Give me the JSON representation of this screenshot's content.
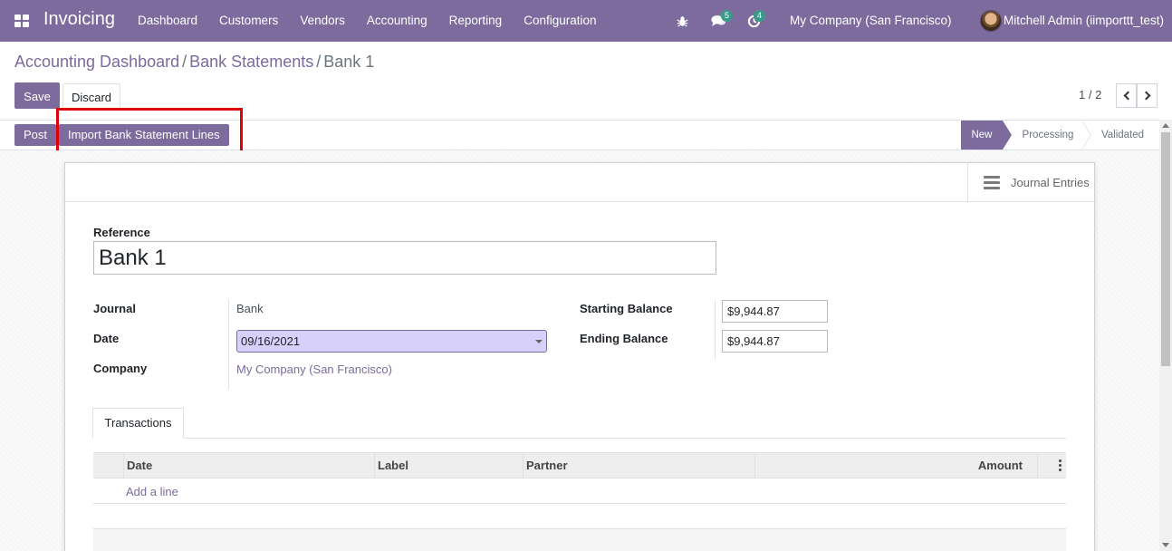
{
  "navbar": {
    "brand": "Invoicing",
    "menu": [
      "Dashboard",
      "Customers",
      "Vendors",
      "Accounting",
      "Reporting",
      "Configuration"
    ],
    "messages_count": "5",
    "activities_count": "4",
    "company": "My Company (San Francisco)",
    "user": "Mitchell Admin (iimporttt_test)"
  },
  "breadcrumb": {
    "items": [
      "Accounting Dashboard",
      "Bank Statements"
    ],
    "separator": "/",
    "current": "Bank 1"
  },
  "actions": {
    "save_label": "Save",
    "discard_label": "Discard"
  },
  "pager": {
    "value": "1 / 2"
  },
  "statusbar": {
    "post_label": "Post",
    "import_label": "Import Bank Statement Lines",
    "stages": [
      "New",
      "Processing",
      "Validated"
    ],
    "active_stage": "New"
  },
  "smart_button": {
    "label": "Journal Entries"
  },
  "form": {
    "reference_label": "Reference",
    "reference_value": "Bank 1",
    "journal_label": "Journal",
    "journal_value": "Bank",
    "date_label": "Date",
    "date_value": "09/16/2021",
    "company_label": "Company",
    "company_value": "My Company (San Francisco)",
    "starting_balance_label": "Starting Balance",
    "starting_balance_value": "$9,944.87",
    "ending_balance_label": "Ending Balance",
    "ending_balance_value": "$9,944.87"
  },
  "tabs": {
    "transactions": "Transactions"
  },
  "table": {
    "columns": [
      "Date",
      "Label",
      "Partner",
      "Amount"
    ],
    "add_line": "Add a line"
  },
  "colors": {
    "primary": "#7c6b9c",
    "highlight": "#e0000a",
    "date_input_bg": "#d6d0fb"
  }
}
